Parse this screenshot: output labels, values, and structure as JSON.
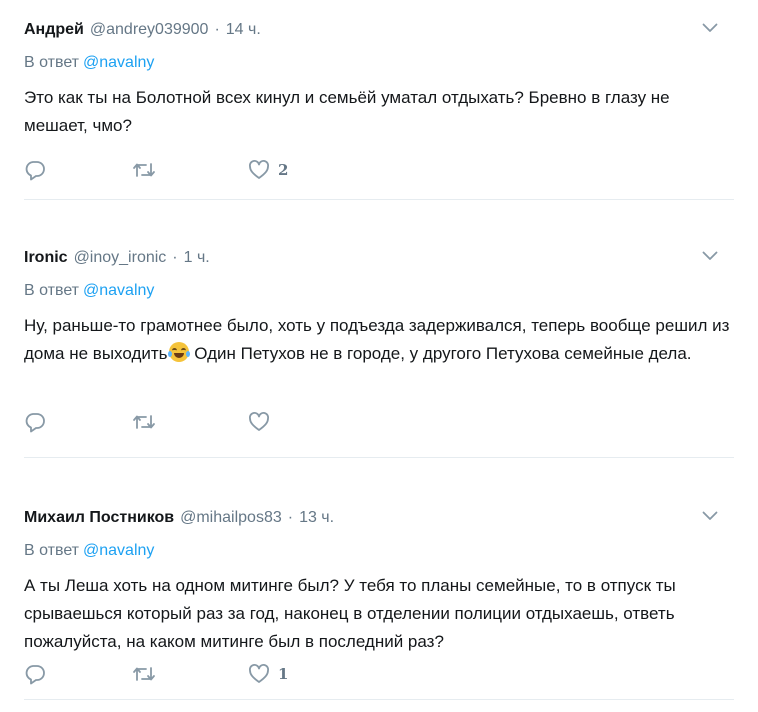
{
  "tweets": [
    {
      "name": "Андрей",
      "handle": "@andrey039900",
      "separator": "·",
      "time": "14 ч.",
      "reply_label": "В ответ",
      "reply_to": "@navalny",
      "text_parts": [
        "Это как ты на Болотной всех кинул и семьёй уматал отдыхать? Бревно в глазу не мешает, чмо?"
      ],
      "likes": "2"
    },
    {
      "name": "Ironic",
      "handle": "@inoy_ironic",
      "separator": "·",
      "time": "1 ч.",
      "reply_label": "В ответ",
      "reply_to": "@navalny",
      "text_parts": [
        "Ну, раньше-то грамотнее было, хоть у подъезда задерживался, теперь вообще решил из дома не выходить",
        " Один Петухов не в городе, у другого Петухова семейные дела."
      ],
      "emoji": "face-with-tears-of-joy-icon",
      "likes": ""
    },
    {
      "name": "Михаил Постников",
      "handle": "@mihailpos83",
      "separator": "·",
      "time": "13 ч.",
      "reply_label": "В ответ",
      "reply_to": "@navalny",
      "text_parts": [
        "А ты Леша хоть на одном митинге был? У тебя то планы семейные, то в отпуск ты срываешься который раз за год, наконец в отделении полиции отдыхаешь, ответь пожалуйста, на каком митинге был в последний раз?"
      ],
      "likes": "1"
    }
  ],
  "icons": {
    "reply": "reply-icon",
    "retweet": "retweet-icon",
    "like": "heart-icon",
    "caret": "chevron-down-icon"
  },
  "colors": {
    "text": "#14171a",
    "muted": "#657786",
    "link": "#1da1f2",
    "divider": "#e6ecf0"
  }
}
